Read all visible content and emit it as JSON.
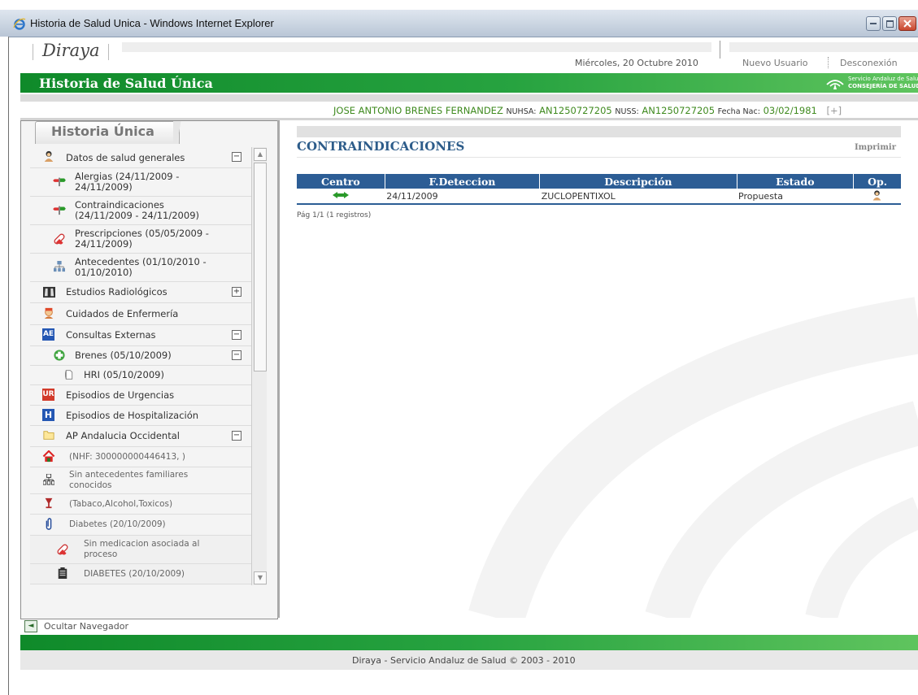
{
  "window": {
    "title": "Historia de Salud Unica - Windows Internet Explorer"
  },
  "header": {
    "logo": "Diraya",
    "date": "Miércoles, 20 Octubre 2010",
    "new_user": "Nuevo Usuario",
    "logout": "Desconexión",
    "app_title": "Historia de Salud Única",
    "org_line1": "Servicio Andaluz de Salud",
    "org_line2": "CONSEJERÍA DE SALUD"
  },
  "patient": {
    "name": "JOSE ANTONIO BRENES FERNANDEZ",
    "nuhsa_label": "NUHSA:",
    "nuhsa": "AN1250727205",
    "nuss_label": "NUSS:",
    "nuss": "AN1250727205",
    "birth_label": "Fecha Nac:",
    "birth": "03/02/1981",
    "expand": "[+]"
  },
  "sidebar": {
    "tab": "Historia Única",
    "items": [
      {
        "label": "Datos de salud generales",
        "toggle": "−"
      },
      {
        "label": "Alergias (24/11/2009 -\n24/11/2009)"
      },
      {
        "label": "Contraindicaciones\n(24/11/2009 - 24/11/2009)"
      },
      {
        "label": "Prescripciones (05/05/2009 -\n24/11/2009)"
      },
      {
        "label": "Antecedentes (01/10/2010 -\n01/10/2010)"
      },
      {
        "label": "Estudios Radiológicos",
        "toggle": "+"
      },
      {
        "label": "Cuidados de Enfermería"
      },
      {
        "label": "Consultas Externas",
        "toggle": "−"
      },
      {
        "label": "Brenes (05/10/2009)",
        "toggle": "−"
      },
      {
        "label": "HRI (05/10/2009)"
      },
      {
        "label": "Episodios de Urgencias"
      },
      {
        "label": "Episodios de Hospitalización"
      },
      {
        "label": "AP Andalucia Occidental",
        "toggle": "−"
      },
      {
        "label": "(NHF: 300000000446413, )"
      },
      {
        "label": "Sin antecedentes familiares\nconocidos"
      },
      {
        "label": "(Tabaco,Alcohol,Toxicos)"
      },
      {
        "label": "Diabetes (20/10/2009)"
      },
      {
        "label": "Sin medicacion asociada al\nproceso"
      },
      {
        "label": "DIABETES (20/10/2009)"
      }
    ],
    "icon_labels": {
      "ae": "AE",
      "ur": "UR",
      "h": "H"
    },
    "hide_nav": "Ocultar Navegador"
  },
  "content": {
    "title": "CONTRAINDICACIONES",
    "print": "Imprimir",
    "columns": [
      "Centro",
      "F.Deteccion",
      "Descripción",
      "Estado",
      "Op."
    ],
    "rows": [
      {
        "date": "24/11/2009",
        "description": "ZUCLOPENTIXOL",
        "status": "Propuesta"
      }
    ],
    "pagination": "Pág 1/1 (1 registros)"
  },
  "footer": {
    "text": "Diraya - Servicio Andaluz de Salud © 2003 - 2010"
  },
  "colors": {
    "green": "#1e9a36",
    "blue": "#2c5d95",
    "patient_green": "#3f8a1f"
  }
}
